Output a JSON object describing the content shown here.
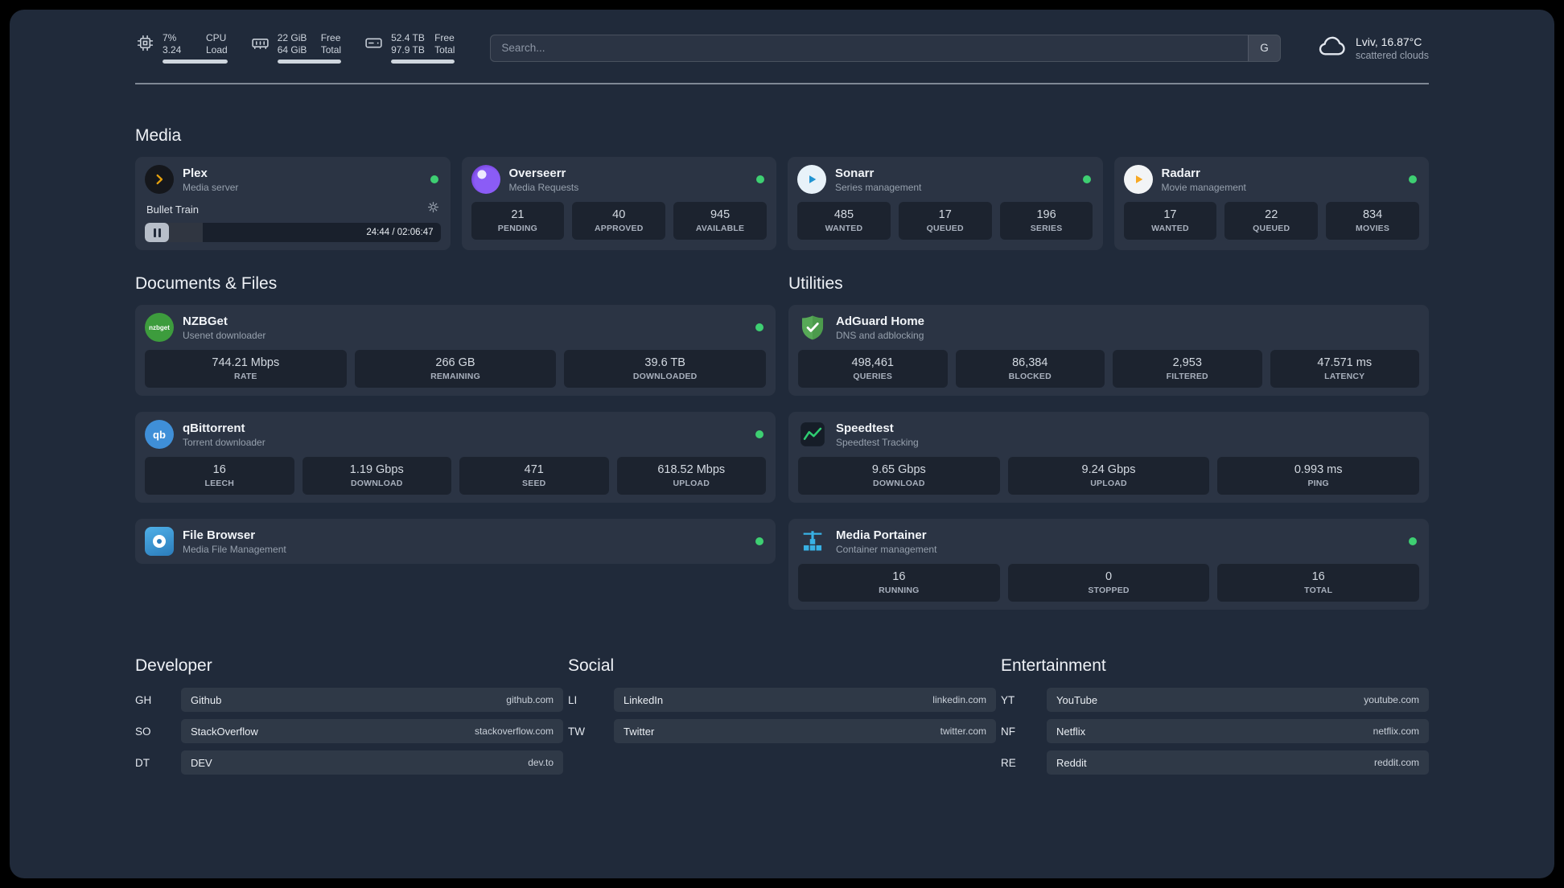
{
  "colors": {
    "background": "#202a3a",
    "status_online": "#3ecf72",
    "plex": "#e5a00d",
    "overseerr": "#7c3aed",
    "sonarr": "#2193d1",
    "radarr": "#f7a823",
    "nzbget": "#3d9c3d",
    "qbittorrent": "#3f8fd8",
    "filebrowser": "#3f9fdc",
    "adguard": "#57a957",
    "speedtest": "#2ecc71",
    "portainer": "#38b1e4"
  },
  "icons": {
    "nzbget_label": "nzbget",
    "qbittorrent_label": "qb"
  },
  "topbar": {
    "resources": [
      {
        "icon": "cpu-icon",
        "rows": [
          {
            "value": "7%",
            "label": "CPU"
          },
          {
            "value": "3.24",
            "label": "Load"
          }
        ]
      },
      {
        "icon": "memory-icon",
        "rows": [
          {
            "value": "22 GiB",
            "label": "Free"
          },
          {
            "value": "64 GiB",
            "label": "Total"
          }
        ]
      },
      {
        "icon": "disk-icon",
        "rows": [
          {
            "value": "52.4 TB",
            "label": "Free"
          },
          {
            "value": "97.9 TB",
            "label": "Total"
          }
        ]
      }
    ],
    "search": {
      "placeholder": "Search...",
      "button_label": "G"
    },
    "weather": {
      "location": "Lviv, 16.87°C",
      "condition": "scattered clouds"
    }
  },
  "media": {
    "title": "Media",
    "cards": [
      {
        "name": "Plex",
        "subtitle": "Media server",
        "status": "online",
        "player": {
          "title": "Bullet Train",
          "time": "24:44 / 02:06:47",
          "progress_percent": 19.5
        }
      },
      {
        "name": "Overseerr",
        "subtitle": "Media Requests",
        "status": "online",
        "stats": [
          {
            "value": "21",
            "label": "PENDING"
          },
          {
            "value": "40",
            "label": "APPROVED"
          },
          {
            "value": "945",
            "label": "AVAILABLE"
          }
        ]
      },
      {
        "name": "Sonarr",
        "subtitle": "Series management",
        "status": "online",
        "stats": [
          {
            "value": "485",
            "label": "WANTED"
          },
          {
            "value": "17",
            "label": "QUEUED"
          },
          {
            "value": "196",
            "label": "SERIES"
          }
        ]
      },
      {
        "name": "Radarr",
        "subtitle": "Movie management",
        "status": "online",
        "stats": [
          {
            "value": "17",
            "label": "WANTED"
          },
          {
            "value": "22",
            "label": "QUEUED"
          },
          {
            "value": "834",
            "label": "MOVIES"
          }
        ]
      }
    ]
  },
  "documents": {
    "title": "Documents & Files",
    "cards": [
      {
        "name": "NZBGet",
        "subtitle": "Usenet downloader",
        "status": "online",
        "stats": [
          {
            "value": "744.21 Mbps",
            "label": "RATE"
          },
          {
            "value": "266 GB",
            "label": "REMAINING"
          },
          {
            "value": "39.6 TB",
            "label": "DOWNLOADED"
          }
        ]
      },
      {
        "name": "qBittorrent",
        "subtitle": "Torrent downloader",
        "status": "online",
        "stats": [
          {
            "value": "16",
            "label": "LEECH"
          },
          {
            "value": "1.19 Gbps",
            "label": "DOWNLOAD"
          },
          {
            "value": "471",
            "label": "SEED"
          },
          {
            "value": "618.52 Mbps",
            "label": "UPLOAD"
          }
        ]
      },
      {
        "name": "File Browser",
        "subtitle": "Media File Management",
        "status": "online"
      }
    ]
  },
  "utilities": {
    "title": "Utilities",
    "cards": [
      {
        "name": "AdGuard Home",
        "subtitle": "DNS and adblocking",
        "stats": [
          {
            "value": "498,461",
            "label": "QUERIES"
          },
          {
            "value": "86,384",
            "label": "BLOCKED"
          },
          {
            "value": "2,953",
            "label": "FILTERED"
          },
          {
            "value": "47.571 ms",
            "label": "LATENCY"
          }
        ]
      },
      {
        "name": "Speedtest",
        "subtitle": "Speedtest Tracking",
        "stats": [
          {
            "value": "9.65 Gbps",
            "label": "DOWNLOAD"
          },
          {
            "value": "9.24 Gbps",
            "label": "UPLOAD"
          },
          {
            "value": "0.993 ms",
            "label": "PING"
          }
        ]
      },
      {
        "name": "Media Portainer",
        "subtitle": "Container management",
        "status": "online",
        "stats": [
          {
            "value": "16",
            "label": "RUNNING"
          },
          {
            "value": "0",
            "label": "STOPPED"
          },
          {
            "value": "16",
            "label": "TOTAL"
          }
        ]
      }
    ]
  },
  "bookmarks": {
    "groups": [
      {
        "title": "Developer",
        "items": [
          {
            "abbr": "GH",
            "name": "Github",
            "url": "github.com"
          },
          {
            "abbr": "SO",
            "name": "StackOverflow",
            "url": "stackoverflow.com"
          },
          {
            "abbr": "DT",
            "name": "DEV",
            "url": "dev.to"
          }
        ]
      },
      {
        "title": "Social",
        "items": [
          {
            "abbr": "LI",
            "name": "LinkedIn",
            "url": "linkedin.com"
          },
          {
            "abbr": "TW",
            "name": "Twitter",
            "url": "twitter.com"
          }
        ]
      },
      {
        "title": "Entertainment",
        "items": [
          {
            "abbr": "YT",
            "name": "YouTube",
            "url": "youtube.com"
          },
          {
            "abbr": "NF",
            "name": "Netflix",
            "url": "netflix.com"
          },
          {
            "abbr": "RE",
            "name": "Reddit",
            "url": "reddit.com"
          }
        ]
      }
    ]
  }
}
